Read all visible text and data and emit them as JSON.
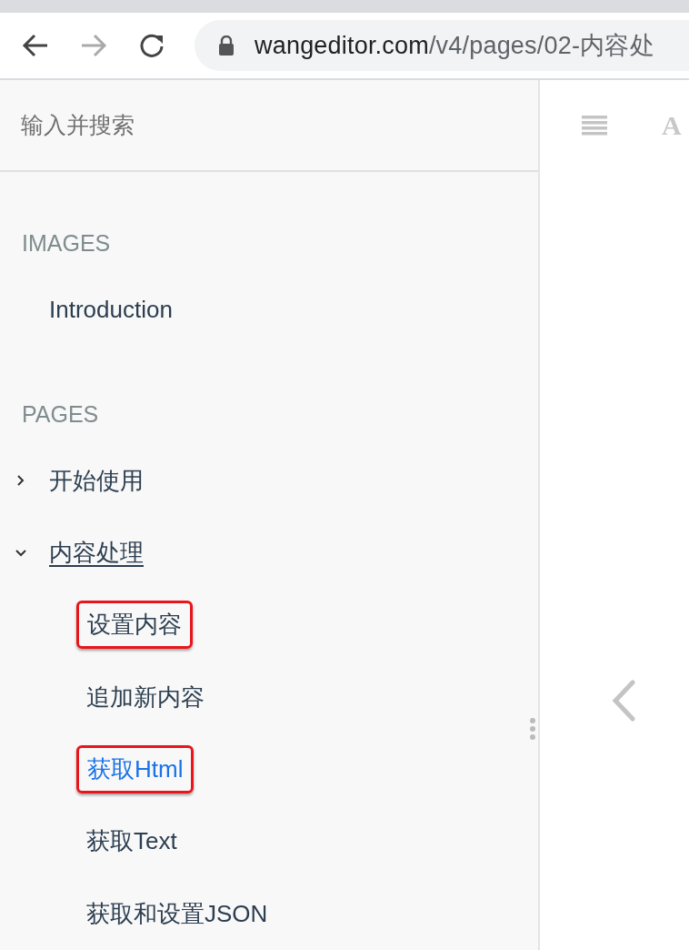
{
  "browser": {
    "url_host": "wangeditor.com",
    "url_path": "/v4/pages/02-内容处"
  },
  "sidebar": {
    "search": {
      "placeholder": "输入并搜索"
    },
    "sections": [
      {
        "heading": "IMAGES",
        "items": [
          {
            "label": "Introduction",
            "kind": "link"
          }
        ]
      },
      {
        "heading": "PAGES",
        "items": [
          {
            "label": "开始使用",
            "kind": "folder",
            "expanded": false,
            "current": false
          },
          {
            "label": "内容处理",
            "kind": "folder",
            "expanded": true,
            "current": true,
            "children": [
              {
                "label": "设置内容",
                "selected": false,
                "boxed": true
              },
              {
                "label": "追加新内容",
                "selected": false,
                "boxed": false
              },
              {
                "label": "获取Html",
                "selected": true,
                "boxed": true
              },
              {
                "label": "获取Text",
                "selected": false,
                "boxed": false
              },
              {
                "label": "获取和设置JSON",
                "selected": false,
                "boxed": false
              }
            ]
          }
        ]
      }
    ]
  },
  "content": {
    "toolbar_font_glyph": "A"
  }
}
